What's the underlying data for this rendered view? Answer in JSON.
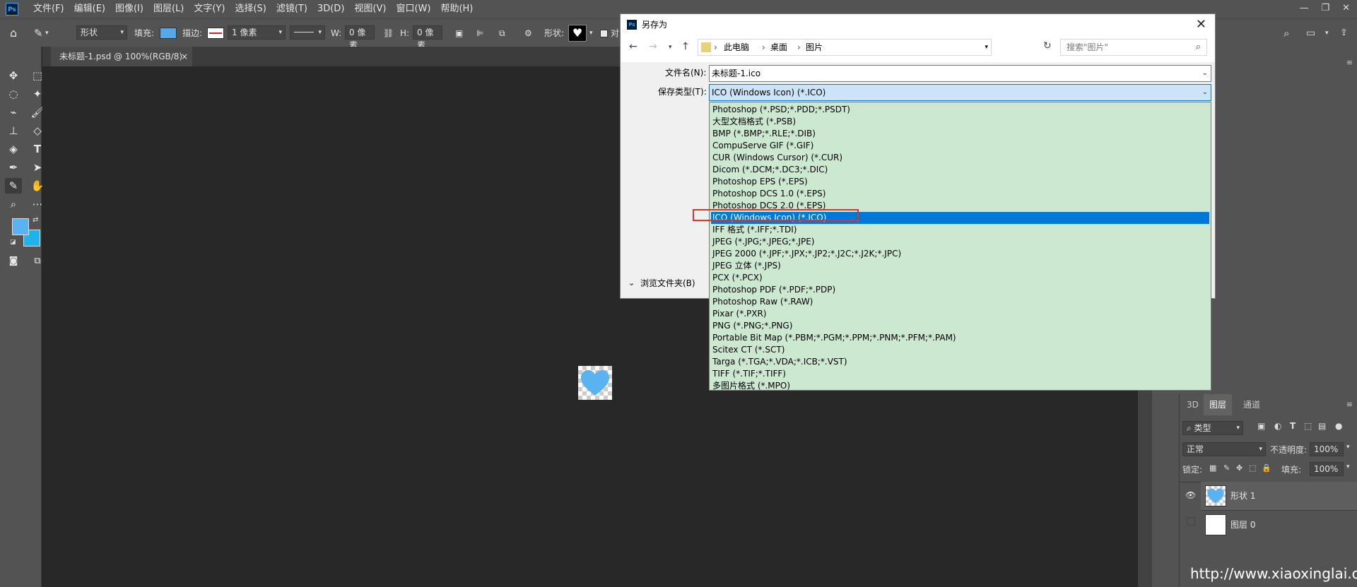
{
  "app": {
    "logo": "Ps"
  },
  "menu": [
    "文件(F)",
    "编辑(E)",
    "图像(I)",
    "图层(L)",
    "文字(Y)",
    "选择(S)",
    "滤镜(T)",
    "3D(D)",
    "视图(V)",
    "窗口(W)",
    "帮助(H)"
  ],
  "window_controls": [
    "—",
    "❐",
    "✕"
  ],
  "options": {
    "mode": "形状",
    "fill_label": "填充:",
    "fill_color": "#5aa7e6",
    "stroke_label": "描边:",
    "stroke_width": "1 像素",
    "w_label": "W:",
    "w_value": "0 像素",
    "h_label": "H:",
    "h_value": "0 像素",
    "shape_label": "形状:",
    "align_label": "对"
  },
  "document_tab": {
    "title": "未标题-1.psd @ 100%(RGB/8)",
    "close": "×"
  },
  "colors": {
    "foreground": "#5ab2f0",
    "background": "#1fb2ef"
  },
  "layers_panel": {
    "tabs": [
      "3D",
      "图层",
      "通道"
    ],
    "filter": "类型",
    "blend_mode": "正常",
    "opacity_label": "不透明度:",
    "opacity": "100%",
    "lock_label": "锁定:",
    "fill_label": "填充:",
    "fill": "100%",
    "layers": [
      {
        "name": "形状 1",
        "visible": true
      },
      {
        "name": "图层 0",
        "visible": false
      }
    ]
  },
  "dialog": {
    "title": "另存为",
    "close": "✕",
    "breadcrumb": [
      "此电脑",
      "桌面",
      "图片"
    ],
    "search_placeholder": "搜索\"图片\"",
    "filename_label": "文件名(N):",
    "filename_value": "未标题-1.ico",
    "type_label": "保存类型(T):",
    "type_value": "ICO (Windows Icon) (*.ICO)",
    "browse_folders": "浏览文件夹(B)",
    "file_types": [
      "Photoshop (*.PSD;*.PDD;*.PSDT)",
      "大型文档格式 (*.PSB)",
      "BMP (*.BMP;*.RLE;*.DIB)",
      "CompuServe GIF (*.GIF)",
      "CUR (Windows Cursor) (*.CUR)",
      "Dicom (*.DCM;*.DC3;*.DIC)",
      "Photoshop EPS (*.EPS)",
      "Photoshop DCS 1.0 (*.EPS)",
      "Photoshop DCS 2.0 (*.EPS)",
      "ICO (Windows Icon) (*.ICO)",
      "IFF 格式 (*.IFF;*.TDI)",
      "JPEG (*.JPG;*.JPEG;*.JPE)",
      "JPEG 2000 (*.JPF;*.JPX;*.JP2;*.J2C;*.J2K;*.JPC)",
      "JPEG 立体 (*.JPS)",
      "PCX (*.PCX)",
      "Photoshop PDF (*.PDF;*.PDP)",
      "Photoshop Raw (*.RAW)",
      "Pixar (*.PXR)",
      "PNG (*.PNG;*.PNG)",
      "Portable Bit Map (*.PBM;*.PGM;*.PPM;*.PNM;*.PFM;*.PAM)",
      "Scitex CT (*.SCT)",
      "Targa (*.TGA;*.VDA;*.ICB;*.VST)",
      "TIFF (*.TIF;*.TIFF)",
      "多图片格式 (*.MPO)"
    ],
    "selected_type_index": 9
  },
  "watermark": "http://www.xiaoxinglai.cn"
}
